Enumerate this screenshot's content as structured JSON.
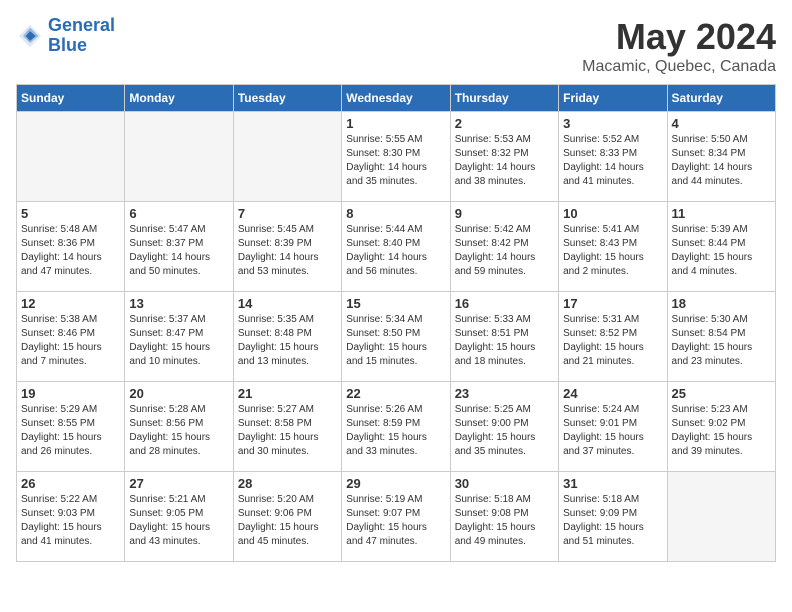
{
  "header": {
    "logo_line1": "General",
    "logo_line2": "Blue",
    "month_year": "May 2024",
    "location": "Macamic, Quebec, Canada"
  },
  "days_of_week": [
    "Sunday",
    "Monday",
    "Tuesday",
    "Wednesday",
    "Thursday",
    "Friday",
    "Saturday"
  ],
  "weeks": [
    [
      {
        "day": "",
        "empty": true
      },
      {
        "day": "",
        "empty": true
      },
      {
        "day": "",
        "empty": true
      },
      {
        "day": "1",
        "sunrise": "Sunrise: 5:55 AM",
        "sunset": "Sunset: 8:30 PM",
        "daylight": "Daylight: 14 hours and 35 minutes."
      },
      {
        "day": "2",
        "sunrise": "Sunrise: 5:53 AM",
        "sunset": "Sunset: 8:32 PM",
        "daylight": "Daylight: 14 hours and 38 minutes."
      },
      {
        "day": "3",
        "sunrise": "Sunrise: 5:52 AM",
        "sunset": "Sunset: 8:33 PM",
        "daylight": "Daylight: 14 hours and 41 minutes."
      },
      {
        "day": "4",
        "sunrise": "Sunrise: 5:50 AM",
        "sunset": "Sunset: 8:34 PM",
        "daylight": "Daylight: 14 hours and 44 minutes."
      }
    ],
    [
      {
        "day": "5",
        "sunrise": "Sunrise: 5:48 AM",
        "sunset": "Sunset: 8:36 PM",
        "daylight": "Daylight: 14 hours and 47 minutes."
      },
      {
        "day": "6",
        "sunrise": "Sunrise: 5:47 AM",
        "sunset": "Sunset: 8:37 PM",
        "daylight": "Daylight: 14 hours and 50 minutes."
      },
      {
        "day": "7",
        "sunrise": "Sunrise: 5:45 AM",
        "sunset": "Sunset: 8:39 PM",
        "daylight": "Daylight: 14 hours and 53 minutes."
      },
      {
        "day": "8",
        "sunrise": "Sunrise: 5:44 AM",
        "sunset": "Sunset: 8:40 PM",
        "daylight": "Daylight: 14 hours and 56 minutes."
      },
      {
        "day": "9",
        "sunrise": "Sunrise: 5:42 AM",
        "sunset": "Sunset: 8:42 PM",
        "daylight": "Daylight: 14 hours and 59 minutes."
      },
      {
        "day": "10",
        "sunrise": "Sunrise: 5:41 AM",
        "sunset": "Sunset: 8:43 PM",
        "daylight": "Daylight: 15 hours and 2 minutes."
      },
      {
        "day": "11",
        "sunrise": "Sunrise: 5:39 AM",
        "sunset": "Sunset: 8:44 PM",
        "daylight": "Daylight: 15 hours and 4 minutes."
      }
    ],
    [
      {
        "day": "12",
        "sunrise": "Sunrise: 5:38 AM",
        "sunset": "Sunset: 8:46 PM",
        "daylight": "Daylight: 15 hours and 7 minutes."
      },
      {
        "day": "13",
        "sunrise": "Sunrise: 5:37 AM",
        "sunset": "Sunset: 8:47 PM",
        "daylight": "Daylight: 15 hours and 10 minutes."
      },
      {
        "day": "14",
        "sunrise": "Sunrise: 5:35 AM",
        "sunset": "Sunset: 8:48 PM",
        "daylight": "Daylight: 15 hours and 13 minutes."
      },
      {
        "day": "15",
        "sunrise": "Sunrise: 5:34 AM",
        "sunset": "Sunset: 8:50 PM",
        "daylight": "Daylight: 15 hours and 15 minutes."
      },
      {
        "day": "16",
        "sunrise": "Sunrise: 5:33 AM",
        "sunset": "Sunset: 8:51 PM",
        "daylight": "Daylight: 15 hours and 18 minutes."
      },
      {
        "day": "17",
        "sunrise": "Sunrise: 5:31 AM",
        "sunset": "Sunset: 8:52 PM",
        "daylight": "Daylight: 15 hours and 21 minutes."
      },
      {
        "day": "18",
        "sunrise": "Sunrise: 5:30 AM",
        "sunset": "Sunset: 8:54 PM",
        "daylight": "Daylight: 15 hours and 23 minutes."
      }
    ],
    [
      {
        "day": "19",
        "sunrise": "Sunrise: 5:29 AM",
        "sunset": "Sunset: 8:55 PM",
        "daylight": "Daylight: 15 hours and 26 minutes."
      },
      {
        "day": "20",
        "sunrise": "Sunrise: 5:28 AM",
        "sunset": "Sunset: 8:56 PM",
        "daylight": "Daylight: 15 hours and 28 minutes."
      },
      {
        "day": "21",
        "sunrise": "Sunrise: 5:27 AM",
        "sunset": "Sunset: 8:58 PM",
        "daylight": "Daylight: 15 hours and 30 minutes."
      },
      {
        "day": "22",
        "sunrise": "Sunrise: 5:26 AM",
        "sunset": "Sunset: 8:59 PM",
        "daylight": "Daylight: 15 hours and 33 minutes."
      },
      {
        "day": "23",
        "sunrise": "Sunrise: 5:25 AM",
        "sunset": "Sunset: 9:00 PM",
        "daylight": "Daylight: 15 hours and 35 minutes."
      },
      {
        "day": "24",
        "sunrise": "Sunrise: 5:24 AM",
        "sunset": "Sunset: 9:01 PM",
        "daylight": "Daylight: 15 hours and 37 minutes."
      },
      {
        "day": "25",
        "sunrise": "Sunrise: 5:23 AM",
        "sunset": "Sunset: 9:02 PM",
        "daylight": "Daylight: 15 hours and 39 minutes."
      }
    ],
    [
      {
        "day": "26",
        "sunrise": "Sunrise: 5:22 AM",
        "sunset": "Sunset: 9:03 PM",
        "daylight": "Daylight: 15 hours and 41 minutes."
      },
      {
        "day": "27",
        "sunrise": "Sunrise: 5:21 AM",
        "sunset": "Sunset: 9:05 PM",
        "daylight": "Daylight: 15 hours and 43 minutes."
      },
      {
        "day": "28",
        "sunrise": "Sunrise: 5:20 AM",
        "sunset": "Sunset: 9:06 PM",
        "daylight": "Daylight: 15 hours and 45 minutes."
      },
      {
        "day": "29",
        "sunrise": "Sunrise: 5:19 AM",
        "sunset": "Sunset: 9:07 PM",
        "daylight": "Daylight: 15 hours and 47 minutes."
      },
      {
        "day": "30",
        "sunrise": "Sunrise: 5:18 AM",
        "sunset": "Sunset: 9:08 PM",
        "daylight": "Daylight: 15 hours and 49 minutes."
      },
      {
        "day": "31",
        "sunrise": "Sunrise: 5:18 AM",
        "sunset": "Sunset: 9:09 PM",
        "daylight": "Daylight: 15 hours and 51 minutes."
      },
      {
        "day": "",
        "empty": true
      }
    ]
  ]
}
